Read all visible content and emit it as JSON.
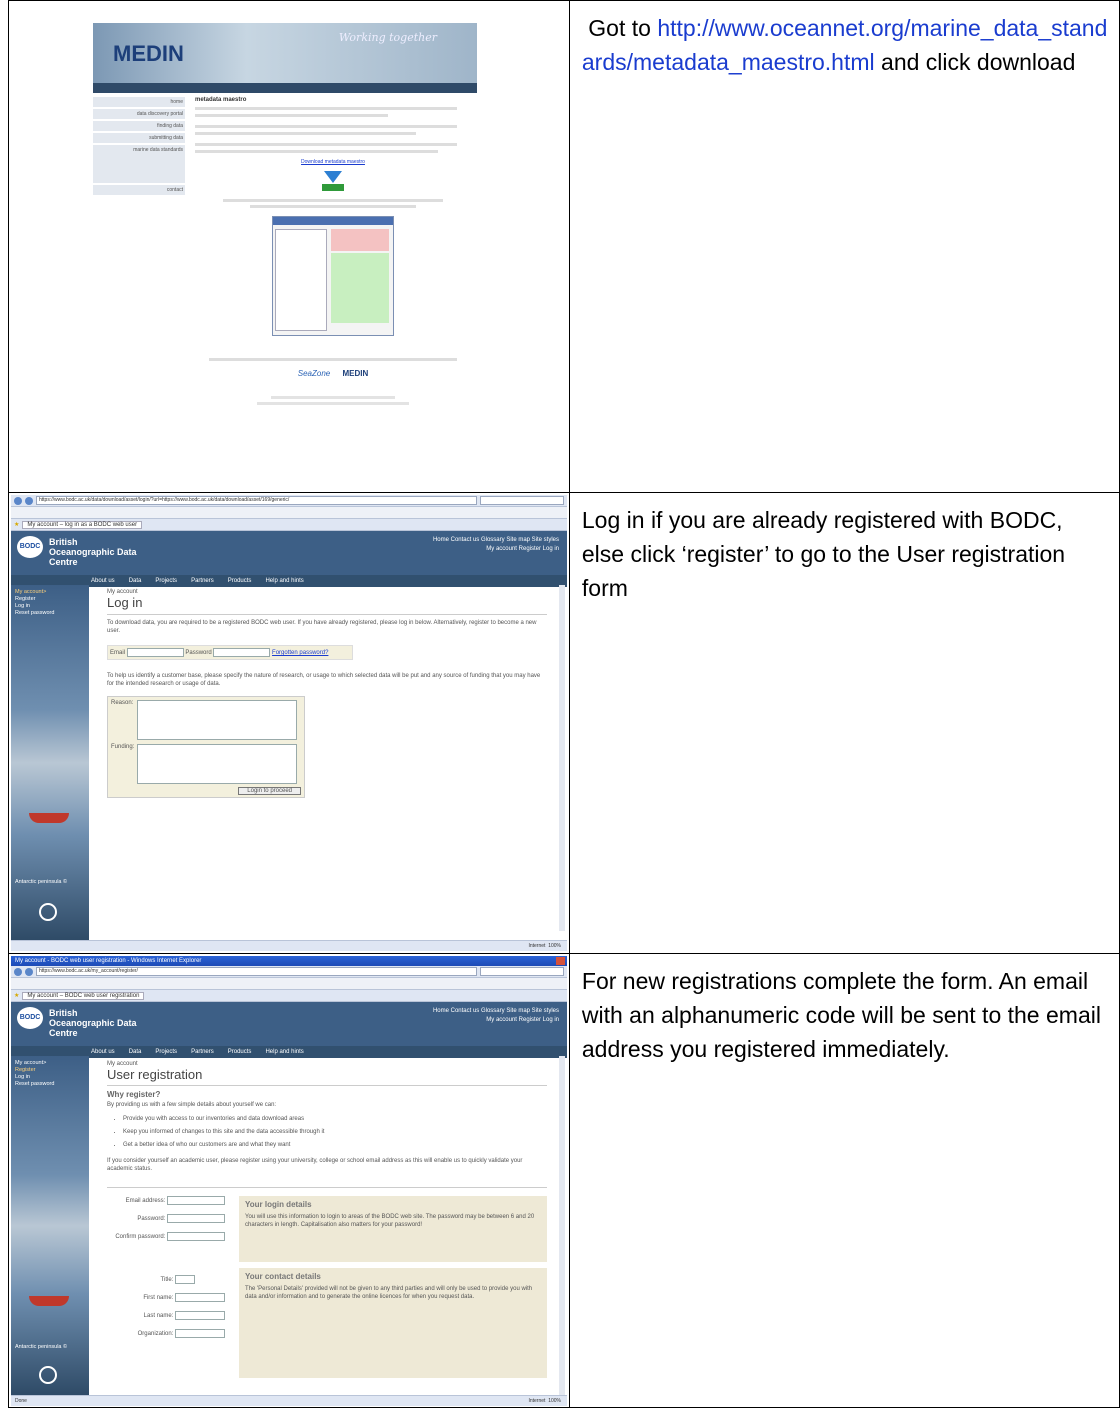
{
  "rows": [
    {
      "instruction_prefix": " Got to ",
      "link": "http://www.oceannet.org/marine_data_standards/metadata_maestro.html",
      "instruction_suffix": " and click download"
    },
    {
      "instruction": "Log in if you are already registered with BODC, else click ‘register’ to go to the User registration form"
    },
    {
      "instruction": "For new registrations complete the form. An email with an alphanumeric code will be sent to the email address you registered immediately."
    }
  ],
  "shot1": {
    "logo": "MEDIN",
    "tagline": "Working together",
    "page_heading": "metadata maestro",
    "download_label": "Download metadata maestro",
    "side_items": [
      "home",
      "data discovery portal",
      "finding data",
      "submitting data",
      "marine data standards",
      "contact"
    ],
    "footer_logos": [
      "SeaZone",
      "MEDIN"
    ]
  },
  "shot2": {
    "url": "https://www.bodc.ac.uk/data/download/asset/login/?url=https://www.bodc.ac.uk/data/download/asset/169/generic/",
    "tab": "My account – log in as a BODC web user",
    "org_name": "British Oceanographic Data Centre",
    "top_links": "Home  Contact us  Glossary  Site map  Site styles",
    "account_links": "My account  Register  Log in",
    "menu": [
      "About us",
      "Data",
      "Projects",
      "Partners",
      "Products",
      "Help and hints"
    ],
    "side": [
      "My account>",
      "Register",
      "Log in",
      "Reset password"
    ],
    "breadcrumb": "My account",
    "title": "Log in",
    "intro": "To download data, you are required to be a registered BODC web user. If you have already registered, please log in below. Alternatively, register to become a new user.",
    "email_label": "Email",
    "password_label": "Password",
    "forgot": "Forgotten password?",
    "help": "To help us identify a customer base, please specify the nature of research, or usage to which selected data will be put and any source of funding that you may have for the intended research or usage of data.",
    "reason_label": "Reason:",
    "funding_label": "Funding:",
    "submit": "Login to proceed",
    "caption": "Antarctic peninsula ©",
    "status": "Internet",
    "zoom": "100%"
  },
  "shot3": {
    "window_title": "My account - BODC web user registration - Windows Internet Explorer",
    "url": "https://www.bodc.ac.uk/my_account/register/",
    "tab": "My account – BODC web user registration",
    "org_name": "British Oceanographic Data Centre",
    "top_links": "Home  Contact us  Glossary  Site map  Site styles",
    "account_links": "My account  Register  Log in",
    "menu": [
      "About us",
      "Data",
      "Projects",
      "Partners",
      "Products",
      "Help and hints"
    ],
    "side": [
      "My account>",
      "Register",
      "Log in",
      "Reset password"
    ],
    "breadcrumb": "My account",
    "title": "User registration",
    "subtitle": "Why register?",
    "lead": "By providing us with a few simple details about yourself we can:",
    "bullets": [
      "Provide you with access to our inventories and data download areas",
      "Keep you informed of changes to this site and the data accessible through it",
      "Get a better idea of who our customers are and what they want"
    ],
    "academic": "If you consider yourself an academic user, please register using your university, college or school email address as this will enable us to quickly validate your academic status.",
    "fields": [
      "Email address:",
      "Password:",
      "Confirm password:",
      "Title:",
      "First name:",
      "Last name:",
      "Organization:"
    ],
    "login_box_title": "Your login details",
    "login_box_text": "You will use this information to login to areas of the BODC web site. The password may be between 6 and 20 characters in length. Capitalisation also matters for your password!",
    "contact_box_title": "Your contact details",
    "contact_box_text": "The 'Personal Details' provided will not be given to any third parties and will only be used to provide you with data and/or information and to generate the online licences for when you request data.",
    "caption": "Antarctic peninsula ©",
    "status_left": "Done",
    "status": "Internet",
    "zoom": "100%"
  }
}
